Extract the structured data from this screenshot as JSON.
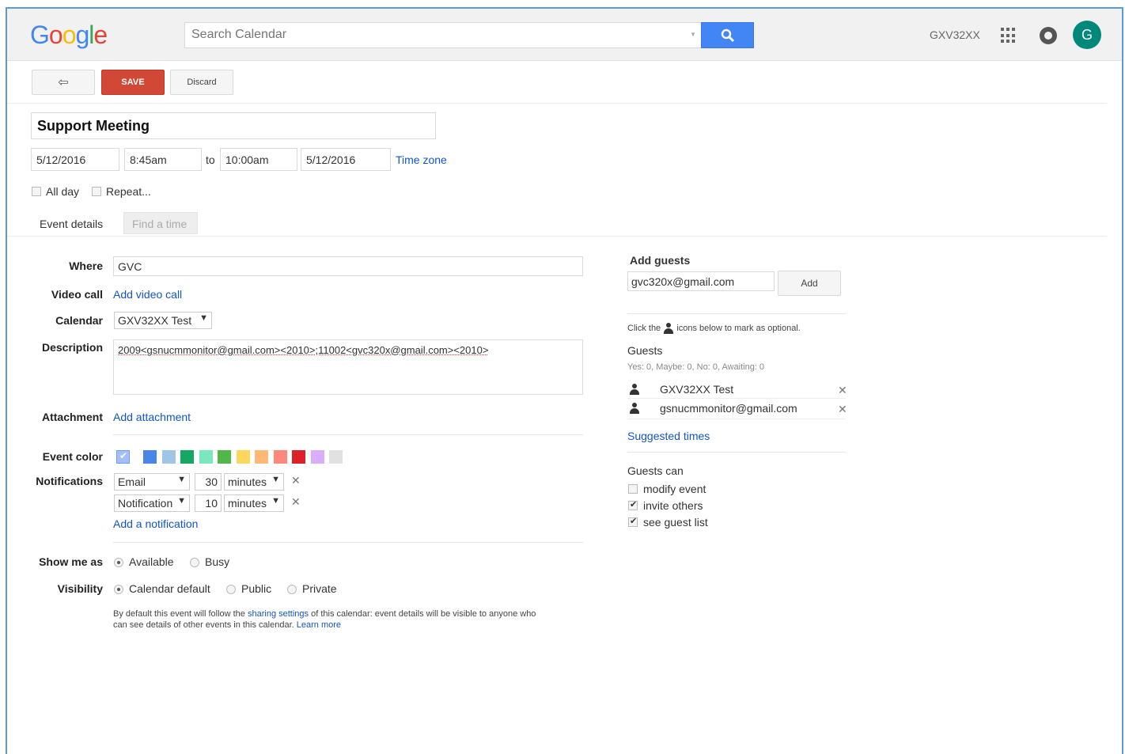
{
  "header": {
    "logo": "Google",
    "search_placeholder": "Search Calendar",
    "account": "GXV32XX",
    "avatar_letter": "G"
  },
  "toolbar": {
    "back_label": "⇦",
    "save_label": "SAVE",
    "discard_label": "Discard"
  },
  "event": {
    "title": "Support Meeting",
    "start_date": "5/12/2016",
    "start_time": "8:45am",
    "to_label": "to",
    "end_time": "10:00am",
    "end_date": "5/12/2016",
    "time_zone_label": "Time zone",
    "all_day_label": "All day",
    "repeat_label": "Repeat..."
  },
  "tabs": {
    "details": "Event details",
    "find_time": "Find a time"
  },
  "details": {
    "where_label": "Where",
    "where_value": "GVC",
    "video_label": "Video call",
    "video_link": "Add video call",
    "calendar_label": "Calendar",
    "calendar_value": "GXV32XX Test",
    "description_label": "Description",
    "description_value": "2009<gsnucmmonitor@gmail.com><2010>;11002<gvc320x@gmail.com><2010>",
    "attachment_label": "Attachment",
    "attachment_link": "Add attachment",
    "color_label": "Event color",
    "colors": [
      "#a4bdfc",
      "#4986e7",
      "#9fc6e7",
      "#16a765",
      "#7ae7bf",
      "#51b749",
      "#fbd75b",
      "#ffb878",
      "#ff887c",
      "#dc2127",
      "#dbadff",
      "#e1e1e1"
    ],
    "notifications_label": "Notifications",
    "notifications": [
      {
        "type": "Email",
        "amount": "30",
        "unit": "minutes"
      },
      {
        "type": "Notification",
        "amount": "10",
        "unit": "minutes"
      }
    ],
    "add_notification": "Add a notification",
    "show_me_as_label": "Show me as",
    "available": "Available",
    "busy": "Busy",
    "visibility_label": "Visibility",
    "calendar_default": "Calendar default",
    "public": "Public",
    "private": "Private",
    "visibility_note_1": "By default this event will follow the",
    "sharing_settings": "sharing settings",
    "visibility_note_2": "of this calendar: event details will be visible to anyone who",
    "visibility_note_3": "can see details of other events in this calendar.",
    "learn_more": "Learn more"
  },
  "guests": {
    "add_label": "Add guests",
    "input_value": "gvc320x@gmail.com",
    "add_button": "Add",
    "hint_1": "Click the",
    "hint_2": "icons below to mark as optional.",
    "guests_title": "Guests",
    "counts": "Yes: 0, Maybe: 0, No: 0, Awaiting: 0",
    "list": [
      {
        "name": "GXV32XX Test"
      },
      {
        "name": "gsnucmmonitor@gmail.com"
      }
    ],
    "suggested_times": "Suggested times",
    "can_title": "Guests can",
    "modify": "modify event",
    "invite": "invite others",
    "see_list": "see guest list"
  }
}
